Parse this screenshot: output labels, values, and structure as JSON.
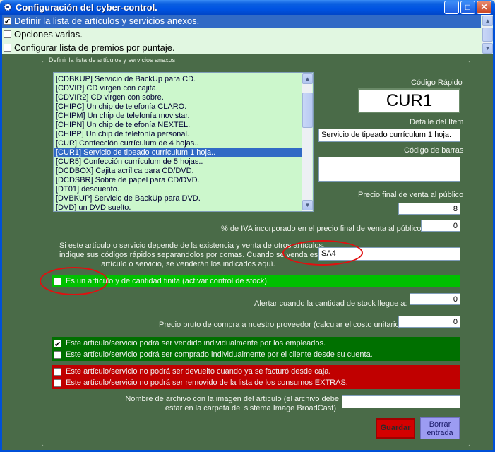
{
  "window": {
    "title": "Configuración del cyber-control.",
    "minimize_glyph": "_",
    "maximize_glyph": "□",
    "close_glyph": "✕"
  },
  "top_options": [
    {
      "label": "Definir la lista de artículos y servicios anexos.",
      "checked": true,
      "selected": true
    },
    {
      "label": "Opciones varias.",
      "checked": false,
      "selected": false
    },
    {
      "label": "Configurar lista de premios por puntaje.",
      "checked": false,
      "selected": false
    }
  ],
  "group_title": "Definir la lista de artículos y servicios anexos",
  "items": [
    "[CDBKUP] Servicio de BackUp para CD.",
    "[CDVIR] CD virgen con cajita.",
    "[CDVIR2] CD virgen con sobre.",
    "[CHIPC] Un chip de telefonía CLARO.",
    "[CHIPM] Un chip de telefonía movistar.",
    "[CHIPN] Un chip de telefonía NEXTEL.",
    "[CHIPP] Un chip de telefonía personal.",
    "[CUR] Confección currículum de 4 hojas..",
    "[CUR1] Servicio de tipeado currículum 1 hoja..",
    "[CUR5] Confección currículum de 5 hojas..",
    "[DCDBOX] Cajita acrílica para CD/DVD.",
    "[DCDSBR] Sobre de papel para CD/DVD.",
    "[DT01] descuento.",
    "[DVBKUP] Servicio de BackUp para DVD.",
    "[DVD] un DVD suelto."
  ],
  "selected_item_index": 8,
  "quick_code": {
    "label": "Código Rápido",
    "value": "CUR1"
  },
  "item_detail": {
    "label": "Detalle del Item",
    "value": "Servicio de tipeado currículum 1 hoja."
  },
  "barcode": {
    "label": "Código de barras",
    "value": ""
  },
  "final_price": {
    "label": "Precio final de venta al público",
    "value": "8"
  },
  "iva": {
    "label": "% de IVA incorporado en el precio final de venta al público",
    "value": "0"
  },
  "dependencies": {
    "line1": "Si este artículo o servicio depende de la existencia y venta de otros artículos,",
    "line2": "indique sus códigos rápidos separandolos por comas. Cuando se venda este",
    "line3": "artículo o servicio, se venderán los indicados aquí.",
    "value": "SA4"
  },
  "stock_control": {
    "label": "Es un artículo y de cantidad finita (activar control de stock).",
    "checked": false
  },
  "stock_alert": {
    "label": "Alertar cuando la cantidad de stock llegue a:",
    "value": "0"
  },
  "gross_price": {
    "label": "Precio bruto de compra a nuestro proveedor (calcular el costo unitario)",
    "value": "0"
  },
  "sell_individually": {
    "label": "Este artículo/servicio podrá ser vendido individualmente por los empleados.",
    "checked": true
  },
  "buy_individually": {
    "label": "Este artículo/servicio podrá ser comprado individualmente por el cliente desde su cuenta.",
    "checked": false
  },
  "no_return": {
    "label": "Este artículo/servicio no podrá ser devuelto cuando ya se facturó desde caja.",
    "checked": false
  },
  "no_remove": {
    "label": "Este artículo/servicio no podrá ser removido de la lista de los consumos EXTRAS.",
    "checked": false
  },
  "image_file": {
    "line1": "Nombre de archivo con la imagen del artículo (el archivo debe",
    "line2": "estar en la carpeta del sistema Image BroadCast)",
    "value": ""
  },
  "buttons": {
    "save": "Guardar",
    "clear_line1": "Borrar",
    "clear_line2": "entrada"
  },
  "colors": {
    "background": "#4a6b48",
    "list_green": "#ccf7cc",
    "green_bar": "#00c000",
    "dark_green_bar": "#007000",
    "red_bar": "#c00000",
    "selection_blue": "#316ac5",
    "annotation_red": "#e01010"
  }
}
